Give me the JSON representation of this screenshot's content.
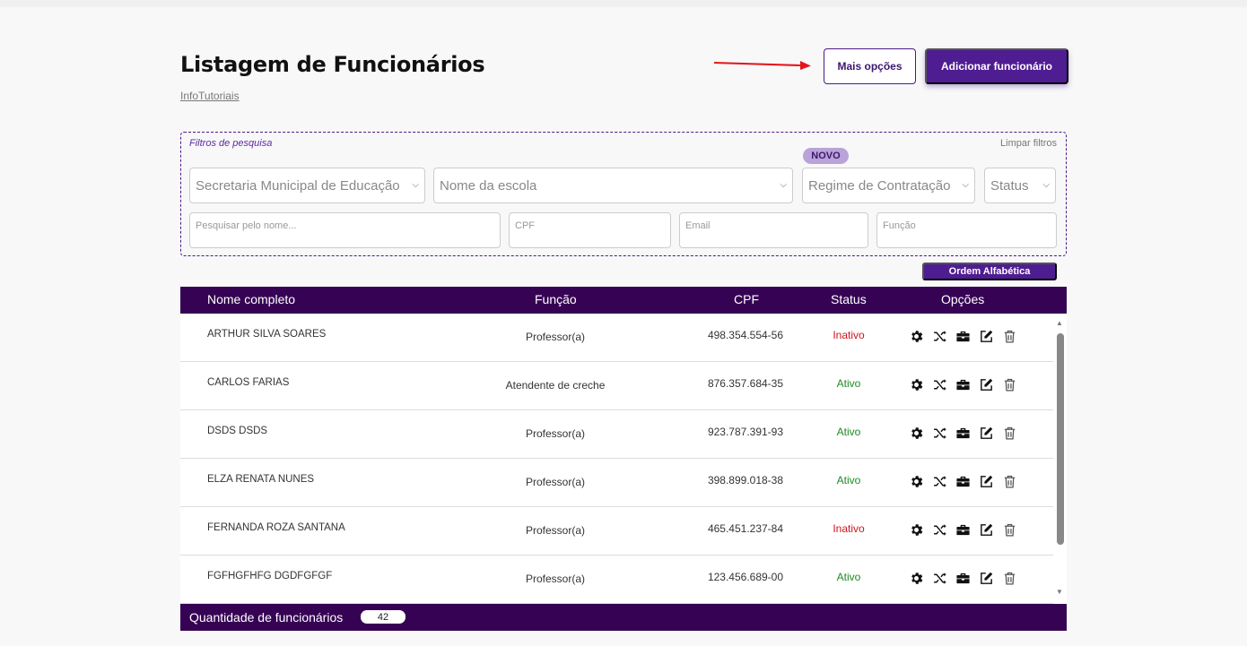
{
  "header": {
    "title": "Listagem de Funcionários",
    "subtitle": "InfoTutoriais",
    "more_options_label": "Mais opções",
    "add_employee_label": "Adicionar funcionário"
  },
  "filters": {
    "label": "Filtros de pesquisa",
    "clear_label": "Limpar filtros",
    "new_badge": "NOVO",
    "selects": {
      "department": "Secretaria Municipal de Educação",
      "school": "Nome da escola",
      "contract": "Regime de Contratação",
      "status": "Status"
    },
    "inputs": {
      "name_placeholder": "Pesquisar pelo nome...",
      "cpf_placeholder": "CPF",
      "email_placeholder": "Email",
      "function_placeholder": "Função"
    }
  },
  "order_button": "Ordem Alfabética",
  "table": {
    "columns": {
      "name": "Nome completo",
      "function": "Função",
      "cpf": "CPF",
      "status": "Status",
      "options": "Opções"
    },
    "rows": [
      {
        "name": "ARTHUR SILVA SOARES",
        "function": "Professor(a)",
        "cpf": "498.354.554-56",
        "status": "Inativo"
      },
      {
        "name": "CARLOS FARIAS",
        "function": "Atendente de creche",
        "cpf": "876.357.684-35",
        "status": "Ativo"
      },
      {
        "name": "DSDS DSDS",
        "function": "Professor(a)",
        "cpf": "923.787.391-93",
        "status": "Ativo"
      },
      {
        "name": "ELZA  RENATA NUNES",
        "function": "Professor(a)",
        "cpf": "398.899.018-38",
        "status": "Ativo"
      },
      {
        "name": "FERNANDA ROZA SANTANA",
        "function": "Professor(a)",
        "cpf": "465.451.237-84",
        "status": "Inativo"
      },
      {
        "name": "FGFHGFHFG DGDFGFGF",
        "function": "Professor(a)",
        "cpf": "123.456.689-00",
        "status": "Ativo"
      }
    ],
    "row_icons": [
      "gear-icon",
      "shuffle-icon",
      "briefcase-icon",
      "edit-icon",
      "trash-icon"
    ]
  },
  "footer": {
    "label": "Quantidade de funcionários",
    "count": "42"
  },
  "colors": {
    "primary": "#4f1d92",
    "header_bg": "#360354",
    "active": "#1e8a24",
    "inactive": "#d0141c"
  }
}
